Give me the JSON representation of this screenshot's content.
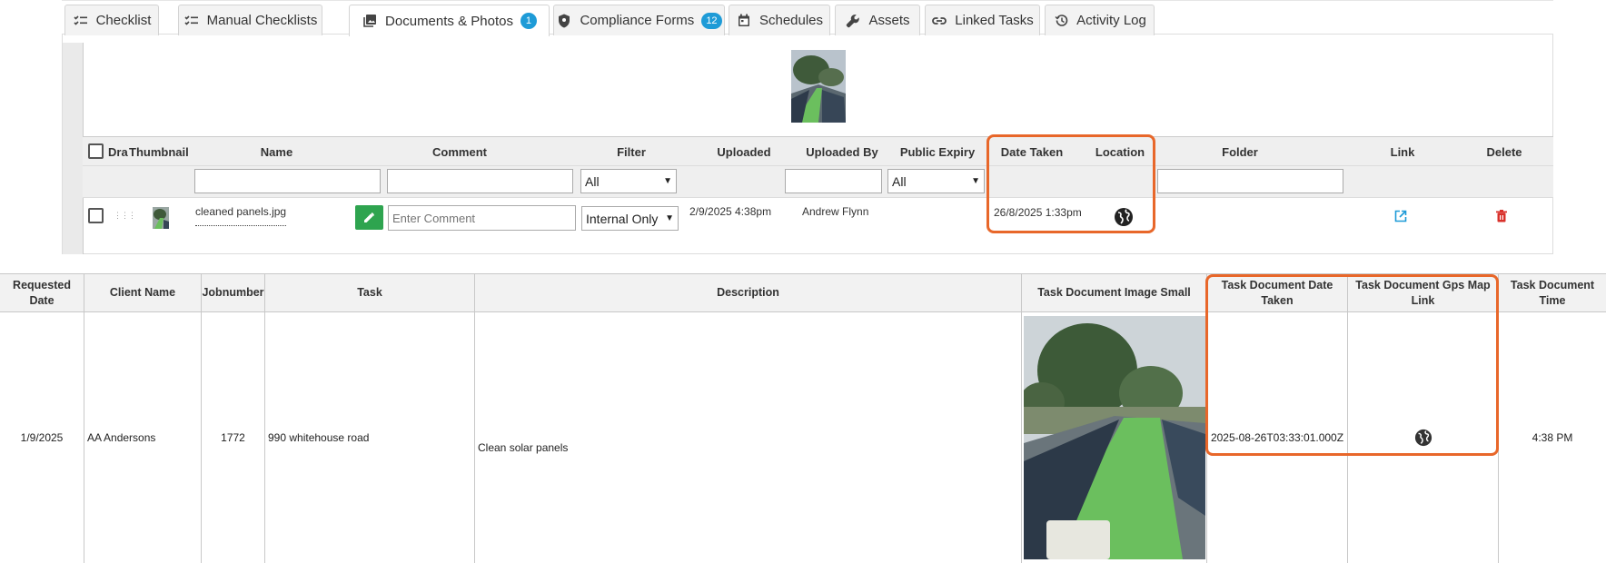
{
  "tabs": [
    {
      "label": "Checklist",
      "icon": "checklist-icon",
      "badge": ""
    },
    {
      "label": "Manual Checklists",
      "icon": "checklist-icon",
      "badge": ""
    },
    {
      "label": "Documents & Photos",
      "icon": "photo-library-icon",
      "badge": "1"
    },
    {
      "label": "Compliance Forms",
      "icon": "shield-icon",
      "badge": "12"
    },
    {
      "label": "Schedules",
      "icon": "calendar-icon",
      "badge": ""
    },
    {
      "label": "Assets",
      "icon": "wrench-icon",
      "badge": ""
    },
    {
      "label": "Linked Tasks",
      "icon": "link-icon",
      "badge": ""
    },
    {
      "label": "Activity Log",
      "icon": "history-icon",
      "badge": ""
    }
  ],
  "docs_table": {
    "headers": {
      "drag": "Dra",
      "thumbnail": "Thumbnail",
      "name": "Name",
      "comment": "Comment",
      "filter": "Filter",
      "uploaded": "Uploaded",
      "uploaded_by": "Uploaded By",
      "public_expiry": "Public Expiry",
      "date_taken": "Date Taken",
      "location": "Location",
      "folder": "Folder",
      "link": "Link",
      "delete": "Delete"
    },
    "filters": {
      "filter_select": "All",
      "public_expiry_select": "All"
    },
    "row": {
      "name": "cleaned panels.jpg",
      "comment_placeholder": "Enter Comment",
      "filter_value": "Internal Only",
      "uploaded": "2/9/2025 4:38pm",
      "uploaded_by": "Andrew Flynn",
      "date_taken": "26/8/2025 1:33pm"
    }
  },
  "report_grid": {
    "headers": {
      "requested_date": "Requested Date",
      "client_name": "Client Name",
      "jobnumber": "Jobnumber",
      "task": "Task",
      "description": "Description",
      "image_small": "Task Document Image Small",
      "date_taken": "Task Document Date Taken",
      "gps_link": "Task Document Gps Map Link",
      "time": "Task Document Time"
    },
    "row": {
      "requested_date": "1/9/2025",
      "client_name": "AA Andersons",
      "jobnumber": "1772",
      "task": "990 whitehouse road",
      "description": "Clean solar panels",
      "date_taken": "2025-08-26T03:33:01.000Z",
      "time": "4:38 PM"
    }
  },
  "colors": {
    "highlight": "#e8672a",
    "badge": "#1e9bd7",
    "edit_button": "#2ea44f",
    "link_icon": "#1e9bd7",
    "delete_icon": "#d9312b"
  }
}
